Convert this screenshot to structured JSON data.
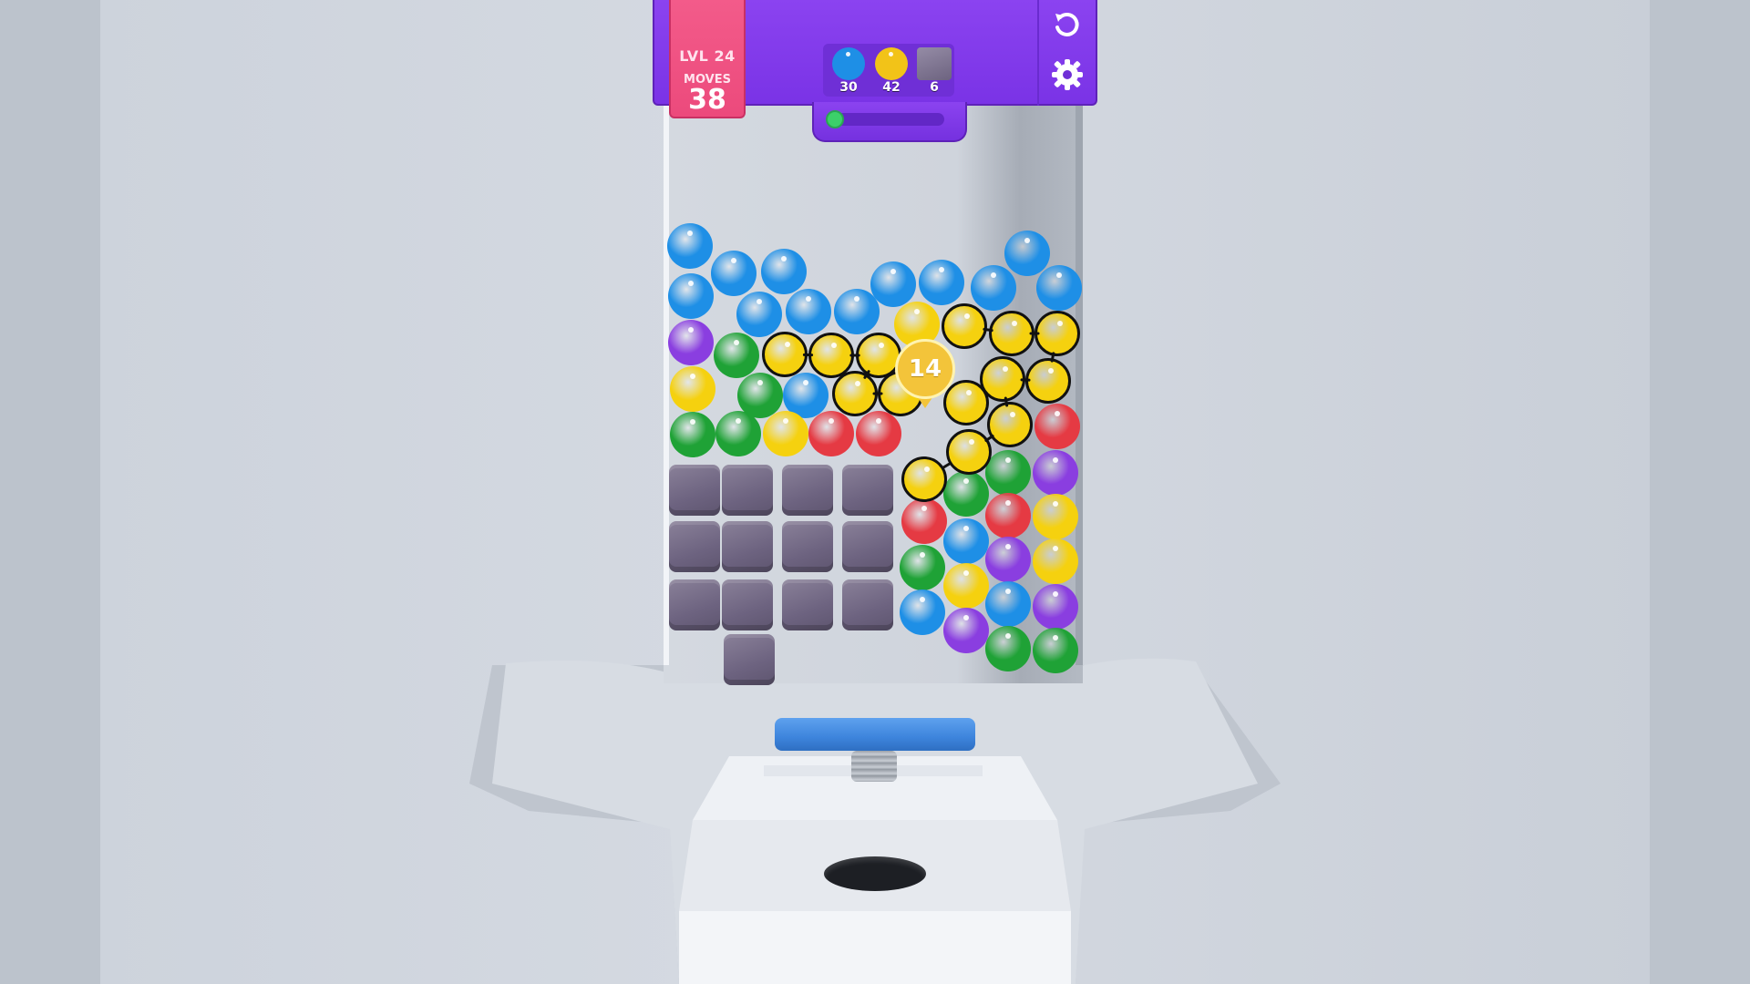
{
  "hud": {
    "level_label": "LVL 24",
    "moves_label": "MOVES",
    "moves_value": "38",
    "goals": [
      {
        "icon": "blue-ball-icon",
        "color": "#1e8fe6",
        "count": "30"
      },
      {
        "icon": "yellow-ball-icon",
        "color": "#f2c318",
        "count": "42"
      },
      {
        "icon": "stone-block-icon",
        "color": "#7a7090",
        "count": "6"
      }
    ],
    "progress": 0.05,
    "restart_icon": "restart-icon",
    "settings_icon": "gear-icon"
  },
  "selection": {
    "count": "14"
  },
  "colors": {
    "blue": "#1e8fe6",
    "yellow": "#f5d10f",
    "green": "#1fa236",
    "red": "#e53a43",
    "purple": "#8a3ee0",
    "hud_purple": "#8b43f0",
    "level_pink": "#f35b8a",
    "plunger_blue": "#3d84dc"
  }
}
